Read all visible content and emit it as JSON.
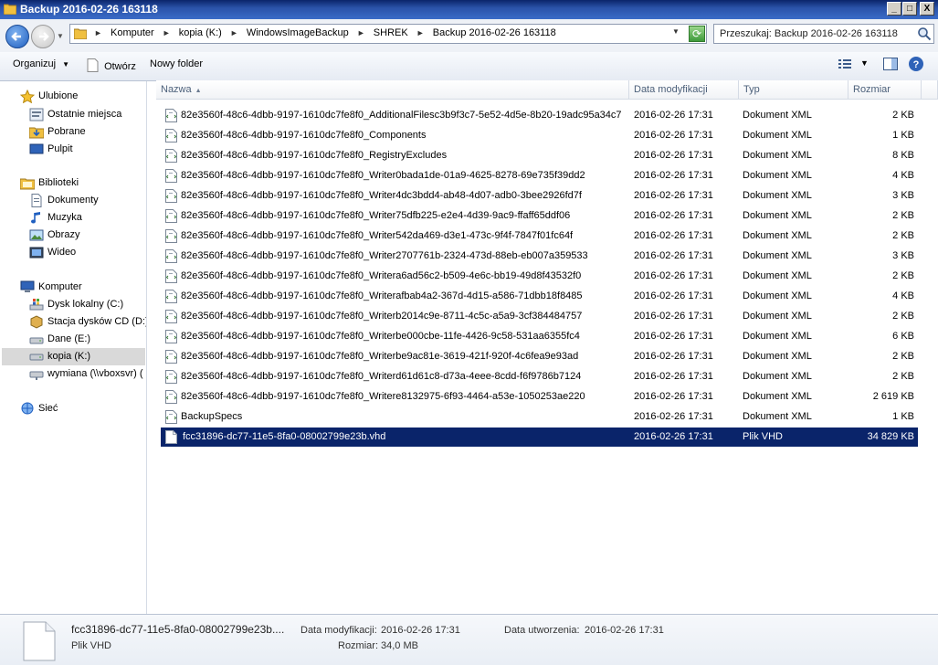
{
  "window": {
    "title": "Backup 2016-02-26 163118",
    "controls": {
      "minimize": "_",
      "maximize": "□",
      "close": "X"
    }
  },
  "address": {
    "breadcrumbs": [
      "Komputer",
      "kopia (K:)",
      "WindowsImageBackup",
      "SHREK",
      "Backup 2016-02-26 163118"
    ]
  },
  "search": {
    "placeholder": "Przeszukaj: Backup 2016-02-26 163118"
  },
  "toolbar": {
    "organize_label": "Organizuj",
    "open_label": "Otwórz",
    "new_folder_label": "Nowy folder"
  },
  "sidebar": {
    "favorites": {
      "label": "Ulubione",
      "items": [
        "Ostatnie miejsca",
        "Pobrane",
        "Pulpit"
      ]
    },
    "libraries": {
      "label": "Biblioteki",
      "items": [
        "Dokumenty",
        "Muzyka",
        "Obrazy",
        "Wideo"
      ]
    },
    "computer": {
      "label": "Komputer",
      "items": [
        "Dysk lokalny (C:)",
        "Stacja dysków CD (D:)",
        "Dane (E:)",
        "kopia (K:)",
        "wymiana (\\\\vboxsvr) ("
      ]
    },
    "network": {
      "label": "Sieć"
    }
  },
  "columns": {
    "name": "Nazwa",
    "date": "Data modyfikacji",
    "type": "Typ",
    "size": "Rozmiar"
  },
  "files": [
    {
      "name": "82e3560f-48c6-4dbb-9197-1610dc7fe8f0_AdditionalFilesc3b9f3c7-5e52-4d5e-8b20-19adc95a34c7",
      "date": "2016-02-26 17:31",
      "type": "Dokument XML",
      "size": "2 KB"
    },
    {
      "name": "82e3560f-48c6-4dbb-9197-1610dc7fe8f0_Components",
      "date": "2016-02-26 17:31",
      "type": "Dokument XML",
      "size": "1 KB"
    },
    {
      "name": "82e3560f-48c6-4dbb-9197-1610dc7fe8f0_RegistryExcludes",
      "date": "2016-02-26 17:31",
      "type": "Dokument XML",
      "size": "8 KB"
    },
    {
      "name": "82e3560f-48c6-4dbb-9197-1610dc7fe8f0_Writer0bada1de-01a9-4625-8278-69e735f39dd2",
      "date": "2016-02-26 17:31",
      "type": "Dokument XML",
      "size": "4 KB"
    },
    {
      "name": "82e3560f-48c6-4dbb-9197-1610dc7fe8f0_Writer4dc3bdd4-ab48-4d07-adb0-3bee2926fd7f",
      "date": "2016-02-26 17:31",
      "type": "Dokument XML",
      "size": "3 KB"
    },
    {
      "name": "82e3560f-48c6-4dbb-9197-1610dc7fe8f0_Writer75dfb225-e2e4-4d39-9ac9-ffaff65ddf06",
      "date": "2016-02-26 17:31",
      "type": "Dokument XML",
      "size": "2 KB"
    },
    {
      "name": "82e3560f-48c6-4dbb-9197-1610dc7fe8f0_Writer542da469-d3e1-473c-9f4f-7847f01fc64f",
      "date": "2016-02-26 17:31",
      "type": "Dokument XML",
      "size": "2 KB"
    },
    {
      "name": "82e3560f-48c6-4dbb-9197-1610dc7fe8f0_Writer2707761b-2324-473d-88eb-eb007a359533",
      "date": "2016-02-26 17:31",
      "type": "Dokument XML",
      "size": "3 KB"
    },
    {
      "name": "82e3560f-48c6-4dbb-9197-1610dc7fe8f0_Writera6ad56c2-b509-4e6c-bb19-49d8f43532f0",
      "date": "2016-02-26 17:31",
      "type": "Dokument XML",
      "size": "2 KB"
    },
    {
      "name": "82e3560f-48c6-4dbb-9197-1610dc7fe8f0_Writerafbab4a2-367d-4d15-a586-71dbb18f8485",
      "date": "2016-02-26 17:31",
      "type": "Dokument XML",
      "size": "4 KB"
    },
    {
      "name": "82e3560f-48c6-4dbb-9197-1610dc7fe8f0_Writerb2014c9e-8711-4c5c-a5a9-3cf384484757",
      "date": "2016-02-26 17:31",
      "type": "Dokument XML",
      "size": "2 KB"
    },
    {
      "name": "82e3560f-48c6-4dbb-9197-1610dc7fe8f0_Writerbe000cbe-11fe-4426-9c58-531aa6355fc4",
      "date": "2016-02-26 17:31",
      "type": "Dokument XML",
      "size": "6 KB"
    },
    {
      "name": "82e3560f-48c6-4dbb-9197-1610dc7fe8f0_Writerbe9ac81e-3619-421f-920f-4c6fea9e93ad",
      "date": "2016-02-26 17:31",
      "type": "Dokument XML",
      "size": "2 KB"
    },
    {
      "name": "82e3560f-48c6-4dbb-9197-1610dc7fe8f0_Writerd61d61c8-d73a-4eee-8cdd-f6f9786b7124",
      "date": "2016-02-26 17:31",
      "type": "Dokument XML",
      "size": "2 KB"
    },
    {
      "name": "82e3560f-48c6-4dbb-9197-1610dc7fe8f0_Writere8132975-6f93-4464-a53e-1050253ae220",
      "date": "2016-02-26 17:31",
      "type": "Dokument XML",
      "size": "2 619 KB"
    },
    {
      "name": "BackupSpecs",
      "date": "2016-02-26 17:31",
      "type": "Dokument XML",
      "size": "1 KB"
    },
    {
      "name": "fcc31896-dc77-11e5-8fa0-08002799e23b.vhd",
      "date": "2016-02-26 17:31",
      "type": "Plik VHD",
      "size": "34 829 KB"
    }
  ],
  "details": {
    "name": "fcc31896-dc77-11e5-8fa0-08002799e23b....",
    "type": "Plik VHD",
    "modified_label": "Data modyfikacji:",
    "modified_value": "2016-02-26 17:31",
    "created_label": "Data utworzenia:",
    "created_value": "2016-02-26 17:31",
    "size_label": "Rozmiar:",
    "size_value": "34,0 MB"
  },
  "colors": {
    "selection": "#0a246a",
    "titlebar": "#0a246a"
  }
}
